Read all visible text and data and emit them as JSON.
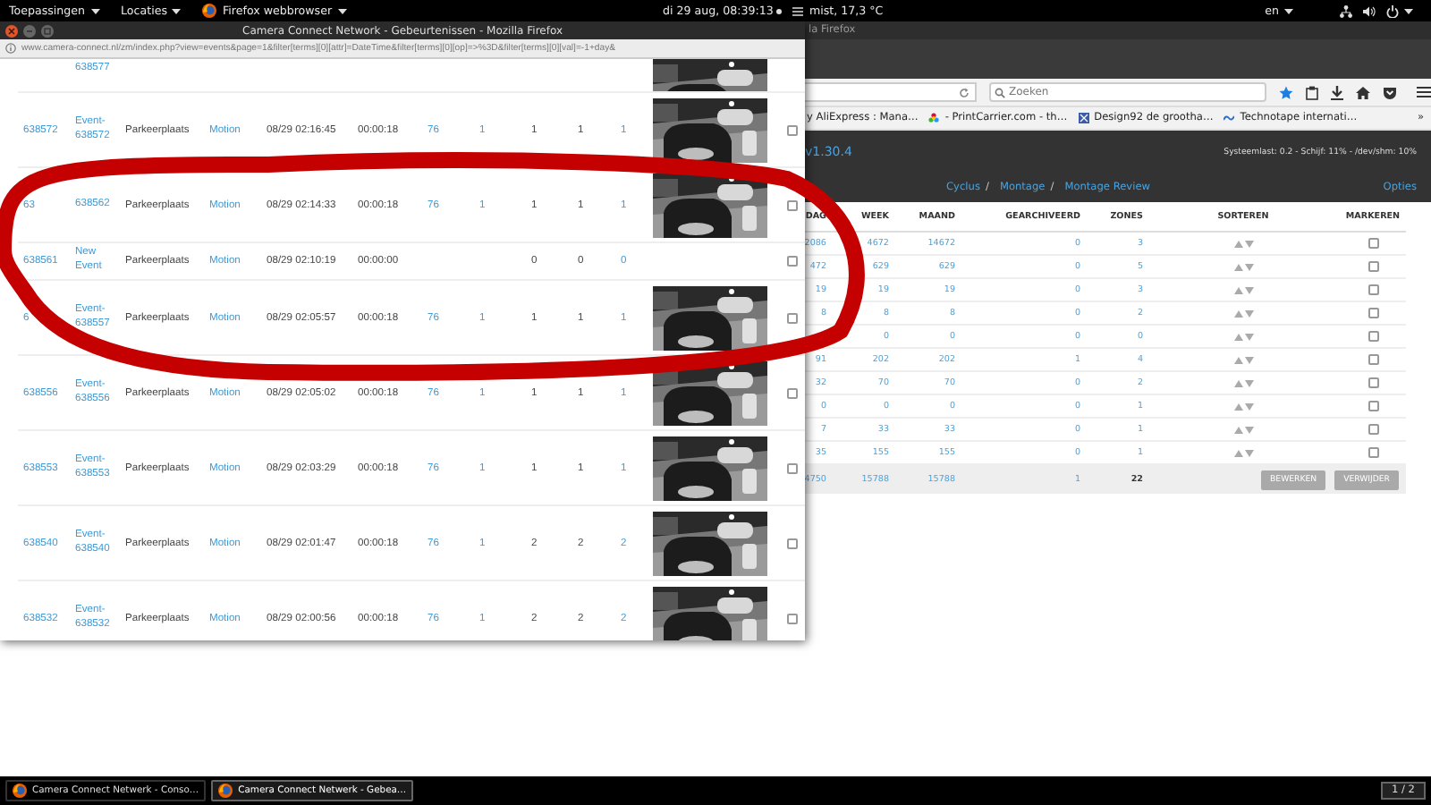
{
  "top_bar": {
    "menus": [
      {
        "label": "Toepassingen"
      },
      {
        "label": "Locaties"
      },
      {
        "label": "Firefox webbrowser",
        "kind": "app"
      }
    ],
    "clock": "di 29 aug, 08:39:13",
    "weather": "mist, 17,3 °C",
    "keyboard": "en"
  },
  "back_window": {
    "title": "la Firefox",
    "search": {
      "placeholder": "Zoeken"
    },
    "bookmarks": [
      {
        "label": "y AliExpress : Mana…"
      },
      {
        "label": "- PrintCarrier.com - th…"
      },
      {
        "label": "Design92 de grootha…"
      },
      {
        "label": "Technotape internati…"
      }
    ],
    "bookmarks_more": "»",
    "version": "v1.30.4",
    "system_load": "Systeemlast: 0.2 - Schijf: 11% - /dev/shm: 10%",
    "nav_links": [
      {
        "label": "Cyclus",
        "after": "/"
      },
      {
        "label": "Montage",
        "after": "/"
      },
      {
        "label": "Montage Review"
      }
    ],
    "options": "Opties",
    "table": {
      "columns": [
        "DAG",
        "WEEK",
        "MAAND",
        "GEARCHIVEERD",
        "ZONES",
        "SORTEREN",
        "MARKEREN"
      ],
      "rows": [
        {
          "dag": "2086",
          "week": "4672",
          "maand": "14672",
          "archived": "0",
          "zones": "3",
          "checked": false
        },
        {
          "dag": "472",
          "week": "629",
          "maand": "629",
          "archived": "0",
          "zones": "5",
          "checked": false
        },
        {
          "dag": "19",
          "week": "19",
          "maand": "19",
          "archived": "0",
          "zones": "3",
          "checked": false
        },
        {
          "dag": "8",
          "week": "8",
          "maand": "8",
          "archived": "0",
          "zones": "2",
          "checked": false
        },
        {
          "week": "0",
          "maand": "0",
          "archived": "0",
          "zones": "0",
          "checked": false
        },
        {
          "dag": "91",
          "week": "202",
          "maand": "202",
          "archived": "1",
          "zones": "4",
          "checked": false
        },
        {
          "dag": "32",
          "week": "70",
          "maand": "70",
          "archived": "0",
          "zones": "2",
          "checked": false
        },
        {
          "dag": "0",
          "week": "0",
          "maand": "0",
          "archived": "0",
          "zones": "1",
          "checked": false
        },
        {
          "dag": "7",
          "week": "33",
          "maand": "33",
          "archived": "0",
          "zones": "1",
          "checked": false
        },
        {
          "dag": "35",
          "week": "155",
          "maand": "155",
          "archived": "0",
          "zones": "1",
          "checked": false
        }
      ],
      "totals": {
        "dag": "4750",
        "week": "15788",
        "maand": "15788",
        "archived": "1",
        "zones": "22"
      },
      "buttons": [
        "BEWERKEN",
        "VERWIJDER"
      ]
    }
  },
  "front_window": {
    "title": "Camera Connect Network - Gebeurtenissen - Mozilla Firefox",
    "url": "www.camera-connect.nl/zm/index.php?view=events&page=1&filter[terms][0][attr]=DateTime&filter[terms][0][op]=>%3D&filter[terms][0][val]=-1+day&",
    "rows": [
      {
        "kind": "partial",
        "name": "638577",
        "thumbnail": true
      },
      {
        "kind": "event",
        "id": "638572",
        "name": "Event-638572",
        "monitor": "Parkeerplaats",
        "cause": "Motion",
        "start": "08/29 02:16:45",
        "duration": "00:00:18",
        "frames": "76",
        "alarm_frames": "1",
        "total_score": "1",
        "avg_score": "1",
        "max_score": "1",
        "thumbnail": true,
        "checked": false
      },
      {
        "kind": "event",
        "id": "63",
        "name": "638562",
        "monitor": "Parkeerplaats",
        "cause": "Motion",
        "start": "08/29 02:14:33",
        "duration": "00:00:18",
        "frames": "76",
        "alarm_frames": "1",
        "total_score": "1",
        "avg_score": "1",
        "max_score": "1",
        "thumbnail": true,
        "checked": false
      },
      {
        "kind": "event",
        "id": "638561",
        "name": "New Event",
        "monitor": "Parkeerplaats",
        "cause": "Motion",
        "start": "08/29 02:10:19",
        "duration": "00:00:00",
        "total_score": "0",
        "avg_score": "0",
        "max_score": "0",
        "thumbnail": false,
        "checked": false
      },
      {
        "kind": "event",
        "id": "6",
        "name": "Event-638557",
        "monitor": "Parkeerplaats",
        "cause": "Motion",
        "start": "08/29 02:05:57",
        "duration": "00:00:18",
        "frames": "76",
        "alarm_frames": "1",
        "total_score": "1",
        "avg_score": "1",
        "max_score": "1",
        "thumbnail": true,
        "checked": false
      },
      {
        "kind": "event",
        "id": "638556",
        "name": "Event-638556",
        "monitor": "Parkeerplaats",
        "cause": "Motion",
        "start": "08/29 02:05:02",
        "duration": "00:00:18",
        "frames": "76",
        "alarm_frames": "1",
        "total_score": "1",
        "avg_score": "1",
        "max_score": "1",
        "thumbnail": true,
        "checked": false
      },
      {
        "kind": "event",
        "id": "638553",
        "name": "Event-638553",
        "monitor": "Parkeerplaats",
        "cause": "Motion",
        "start": "08/29 02:03:29",
        "duration": "00:00:18",
        "frames": "76",
        "alarm_frames": "1",
        "total_score": "1",
        "avg_score": "1",
        "max_score": "1",
        "thumbnail": true,
        "checked": false
      },
      {
        "kind": "event",
        "id": "638540",
        "name": "Event-638540",
        "monitor": "Parkeerplaats",
        "cause": "Motion",
        "start": "08/29 02:01:47",
        "duration": "00:00:18",
        "frames": "76",
        "alarm_frames": "1",
        "total_score": "2",
        "avg_score": "2",
        "max_score": "2",
        "thumbnail": true,
        "checked": false
      },
      {
        "kind": "event",
        "id": "638532",
        "name": "Event-638532",
        "monitor": "Parkeerplaats",
        "cause": "Motion",
        "start": "08/29 02:00:56",
        "duration": "00:00:18",
        "frames": "76",
        "alarm_frames": "1",
        "total_score": "2",
        "avg_score": "2",
        "max_score": "2",
        "thumbnail": true,
        "checked": false
      }
    ]
  },
  "taskbar": {
    "tasks": [
      {
        "label": "Camera Connect Netwerk - Conso…",
        "selected": false
      },
      {
        "label": "Camera Connect Netwerk - Gebea…",
        "selected": true
      }
    ],
    "workspace": "1 / 2"
  }
}
